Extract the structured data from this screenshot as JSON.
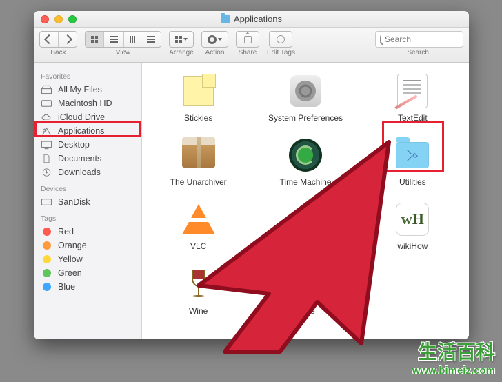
{
  "window": {
    "title": "Applications"
  },
  "toolbar": {
    "back_label": "Back",
    "view_label": "View",
    "arrange_label": "Arrange",
    "action_label": "Action",
    "share_label": "Share",
    "tags_label": "Edit Tags",
    "search_label": "Search",
    "search_placeholder": "Search"
  },
  "sidebar": {
    "sections": {
      "favorites": "Favorites",
      "devices": "Devices",
      "tags": "Tags"
    },
    "favorites": [
      {
        "label": "All My Files"
      },
      {
        "label": "Macintosh HD"
      },
      {
        "label": "iCloud Drive"
      },
      {
        "label": "Applications"
      },
      {
        "label": "Desktop"
      },
      {
        "label": "Documents"
      },
      {
        "label": "Downloads"
      }
    ],
    "devices": [
      {
        "label": "SanDisk"
      }
    ],
    "tags": [
      {
        "label": "Red",
        "color": "#ff5a52"
      },
      {
        "label": "Orange",
        "color": "#ff9a3c"
      },
      {
        "label": "Yellow",
        "color": "#ffd93b"
      },
      {
        "label": "Green",
        "color": "#5ec65a"
      },
      {
        "label": "Blue",
        "color": "#3ea6ff"
      }
    ]
  },
  "apps": [
    {
      "label": "Stickies"
    },
    {
      "label": "System Preferences"
    },
    {
      "label": "TextEdit"
    },
    {
      "label": "The Unarchiver"
    },
    {
      "label": "Time Machine"
    },
    {
      "label": "Utilities"
    },
    {
      "label": "VLC"
    },
    {
      "label": ""
    },
    {
      "label": "wikiHow"
    },
    {
      "label": "Wine"
    },
    {
      "label": "Wine"
    },
    {
      "label": ""
    }
  ],
  "watermark": {
    "cn": "生活百科",
    "url": "www.bimeiz.com"
  }
}
